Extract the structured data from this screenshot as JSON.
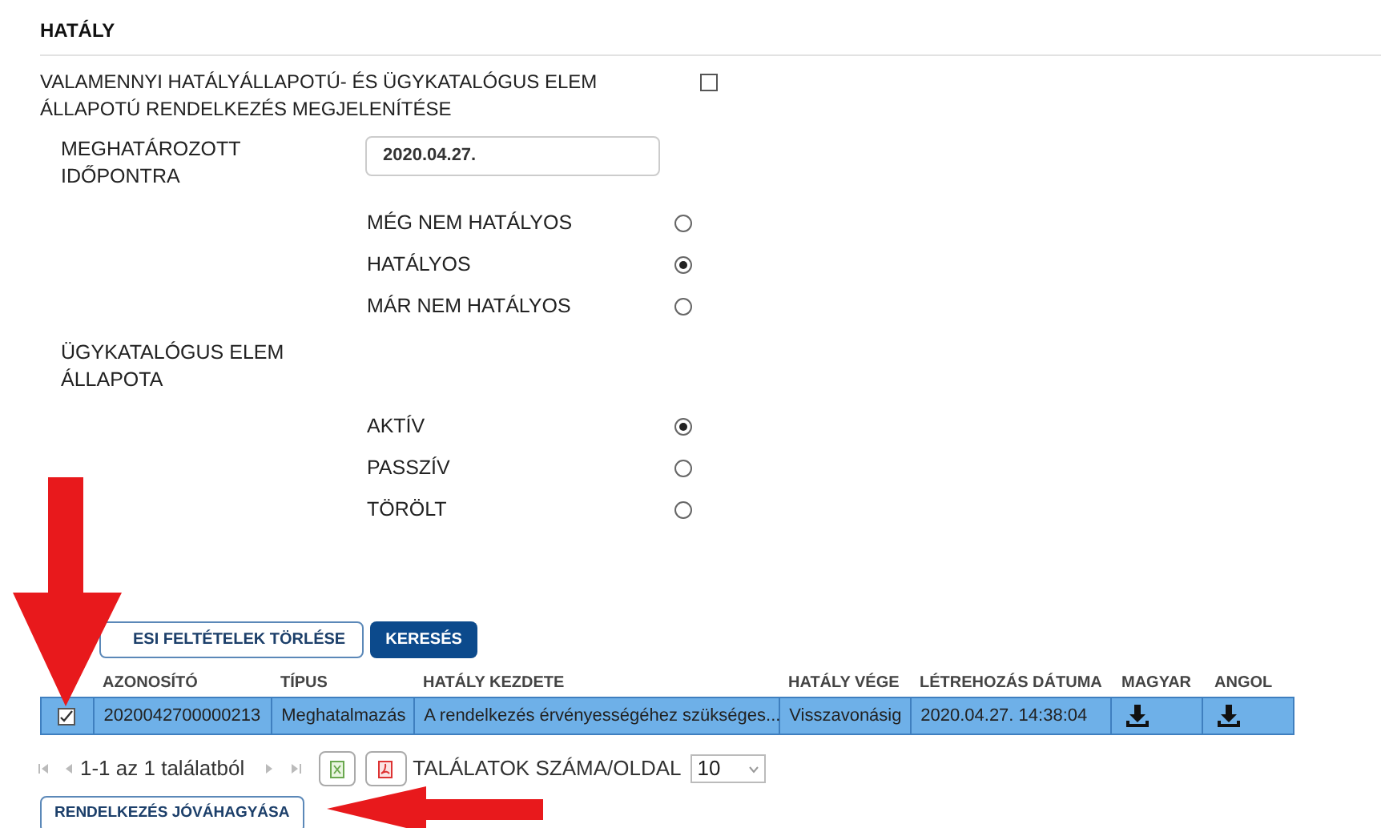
{
  "section": {
    "title": "HATÁLY"
  },
  "show_all": {
    "label": "VALAMENNYI HATÁLYÁLLAPOTÚ- ÉS ÜGYKATALÓGUS ELEM ÁLLAPOTÚ RENDELKEZÉS MEGJELENÍTÉSE",
    "checked": false
  },
  "date": {
    "label": "MEGHATÁROZOTT IDŐPONTRA",
    "value": "2020.04.27."
  },
  "validity_options": [
    {
      "label": "MÉG NEM HATÁLYOS",
      "selected": false
    },
    {
      "label": "HATÁLYOS",
      "selected": true
    },
    {
      "label": "MÁR NEM HATÁLYOS",
      "selected": false
    }
  ],
  "catalog": {
    "label": "ÜGYKATALÓGUS ELEM ÁLLAPOTA"
  },
  "catalog_options": [
    {
      "label": "AKTÍV",
      "selected": true
    },
    {
      "label": "PASSZÍV",
      "selected": false
    },
    {
      "label": "TÖRÖLT",
      "selected": false
    }
  ],
  "buttons": [
    {
      "label": "ESI FELTÉTELEK TÖRLÉSE",
      "kind": "outline"
    },
    {
      "label": "KERESÉS",
      "kind": "primary"
    }
  ],
  "table": {
    "columns": [
      "AZONOSÍTÓ",
      "TÍPUS",
      "HATÁLY KEZDETE",
      "HATÁLY VÉGE",
      "LÉTREHOZÁS DÁTUMA",
      "MAGYAR",
      "ANGOL"
    ],
    "rows": [
      {
        "checked": true,
        "selected": true,
        "cells": [
          "2020042700000213",
          "Meghatalmazás",
          "A rendelkezés érvényességéhez szükséges...",
          "Visszavonásig",
          "2020.04.27. 14:38:04"
        ]
      }
    ]
  },
  "pager": {
    "summary": "1-1 az 1 találatból",
    "page_size_label": "TALÁLATOK SZÁMA/OLDAL",
    "page_size": "10"
  },
  "approve_button": {
    "label": "RENDELKEZÉS JÓVÁHAGYÁSA"
  }
}
